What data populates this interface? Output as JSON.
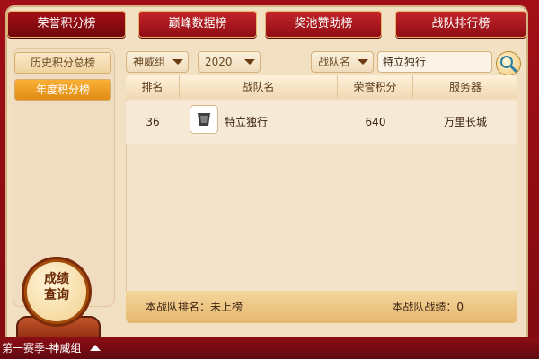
{
  "tabs": [
    {
      "label": "荣誉积分榜",
      "active": true
    },
    {
      "label": "巅峰数据榜",
      "active": false
    },
    {
      "label": "奖池赞助榜",
      "active": false
    },
    {
      "label": "战队排行榜",
      "active": false
    }
  ],
  "sidebar": {
    "items": [
      {
        "label": "历史积分总榜",
        "active": false
      },
      {
        "label": "年度积分榜",
        "active": true
      }
    ]
  },
  "filters": {
    "group": "神威组",
    "year": "2020",
    "search_type": "战队名",
    "search_value": "特立独行"
  },
  "table": {
    "headers": [
      "排名",
      "战队名",
      "荣誉积分",
      "服务器"
    ],
    "rows": [
      {
        "rank": "36",
        "team": "特立独行",
        "points": "640",
        "server": "万里长城"
      }
    ],
    "footer": {
      "left": "本战队排名：未上榜",
      "right": "本战队战绩：0"
    }
  },
  "badge": {
    "label": "成绩\n查询"
  },
  "bottom_bar": {
    "season": "第一赛季-神威组"
  },
  "colors": {
    "accent": "#f39c22",
    "tab_red": "#a50f14",
    "panel": "#f2e0c2"
  }
}
